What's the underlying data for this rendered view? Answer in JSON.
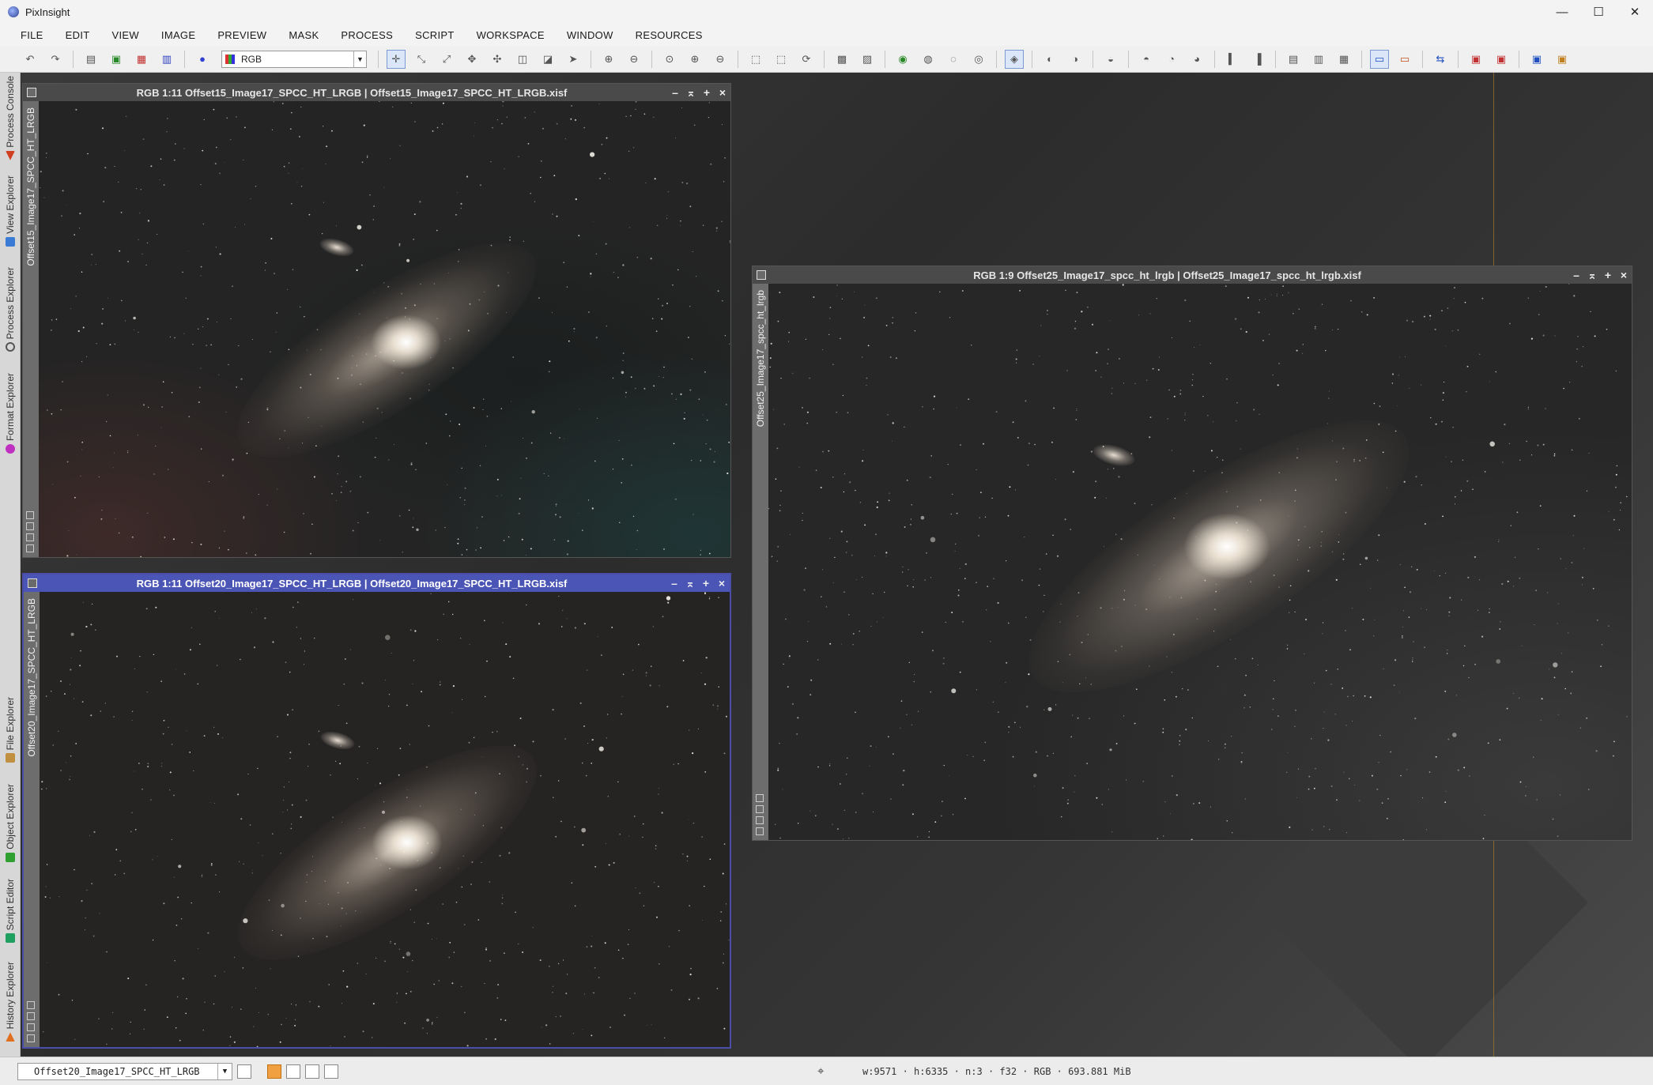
{
  "app": {
    "title": "PixInsight"
  },
  "window_controls": {
    "minimize": "—",
    "maximize": "☐",
    "close": "✕"
  },
  "menu": [
    "FILE",
    "EDIT",
    "VIEW",
    "IMAGE",
    "PREVIEW",
    "MASK",
    "PROCESS",
    "SCRIPT",
    "WORKSPACE",
    "WINDOW",
    "RESOURCES"
  ],
  "toolbar": {
    "channel_select": "RGB"
  },
  "side_tabs": [
    {
      "label": "Process Console",
      "icon": "process-console-icon",
      "color": "#d04020"
    },
    {
      "label": "View Explorer",
      "icon": "view-explorer-icon",
      "color": "#3a7bd5"
    },
    {
      "label": "Process Explorer",
      "icon": "process-explorer-icon",
      "color": "#555555"
    },
    {
      "label": "Format Explorer",
      "icon": "format-explorer-icon",
      "color": "#c030c0"
    },
    {
      "label": "File Explorer",
      "icon": "file-explorer-icon",
      "color": "#c09040"
    },
    {
      "label": "Object Explorer",
      "icon": "object-explorer-icon",
      "color": "#30a030"
    },
    {
      "label": "Script Editor",
      "icon": "script-editor-icon",
      "color": "#20a060"
    },
    {
      "label": "History Explorer",
      "icon": "history-explorer-icon",
      "color": "#e07020"
    }
  ],
  "windows": [
    {
      "title": "RGB 1:11 Offset15_Image17_SPCC_HT_LRGB | Offset15_Image17_SPCC_HT_LRGB.xisf",
      "side_label": "Offset15_Image17_SPCC_HT_LRGB",
      "active": false
    },
    {
      "title": "RGB 1:11 Offset20_Image17_SPCC_HT_LRGB | Offset20_Image17_SPCC_HT_LRGB.xisf",
      "side_label": "Offset20_Image17_SPCC_HT_LRGB",
      "active": true
    },
    {
      "title": "RGB 1:9 Offset25_Image17_spcc_ht_lrgb | Offset25_Image17_spcc_ht_lrgb.xisf",
      "side_label": "Offset25_Image17_spcc_ht_lrgb",
      "active": false
    }
  ],
  "win_ctrl_glyphs": {
    "min": "–",
    "shade": "⌅",
    "max": "+",
    "close": "×"
  },
  "statusbar": {
    "view_selector": "Offset20_Image17_SPCC_HT_LRGB",
    "info": "w:9571 · h:6335 · n:3 · f32 · RGB · 693.881 MiB"
  }
}
